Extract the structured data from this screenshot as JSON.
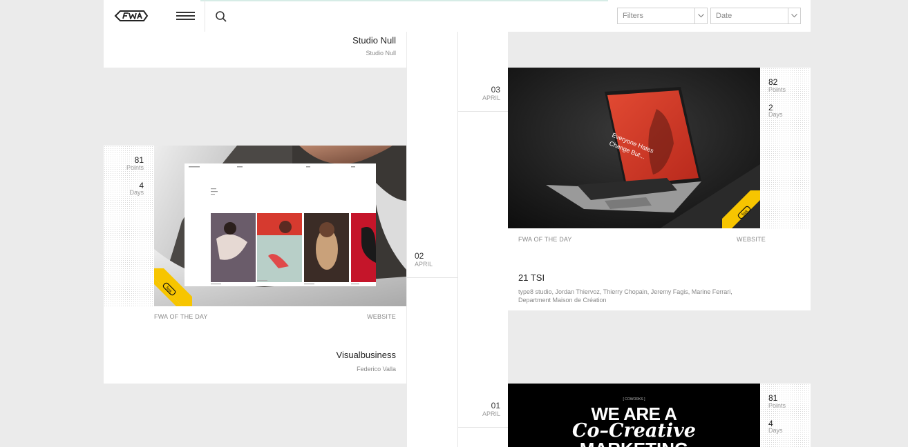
{
  "header": {
    "logo_icon": "fwa-logo",
    "filters_label": "Filters",
    "date_label": "Date"
  },
  "entries": [
    {
      "title": "Studio Null",
      "credit": "Studio Null"
    },
    {
      "points": "81",
      "points_label": "Points",
      "days": "4",
      "days_label": "Days",
      "award": "FWA OF THE DAY",
      "category": "WEBSITE",
      "title": "Visualbusiness",
      "credit": "Federico Valla"
    },
    {
      "points": "82",
      "points_label": "Points",
      "days": "2",
      "days_label": "Days",
      "award": "FWA OF THE DAY",
      "category": "WEBSITE",
      "title": "21 TSI",
      "credit_line1": "type8 studio, Jordan Thiervoz, Thierry Chopain, Jeremy Fagis, Marine Ferrari,",
      "credit_line2": "Department Maison de Création",
      "laptop_text": "Everyone Hates Change But..."
    },
    {
      "points": "81",
      "points_label": "Points",
      "days": "4",
      "days_label": "Days",
      "hero_small": "[ COWORKS ]",
      "hero_line1": "WE ARE A",
      "hero_line2": "Co–Creative",
      "hero_line3": "MARKETING"
    }
  ],
  "timeline": [
    {
      "day": "03",
      "month": "APRIL"
    },
    {
      "day": "02",
      "month": "APRIL"
    },
    {
      "day": "01",
      "month": "APRIL"
    }
  ],
  "badge_text": "fwa",
  "colors": {
    "badge": "#f7c500",
    "accent_red": "#e2452f",
    "background": "#ebebeb"
  }
}
